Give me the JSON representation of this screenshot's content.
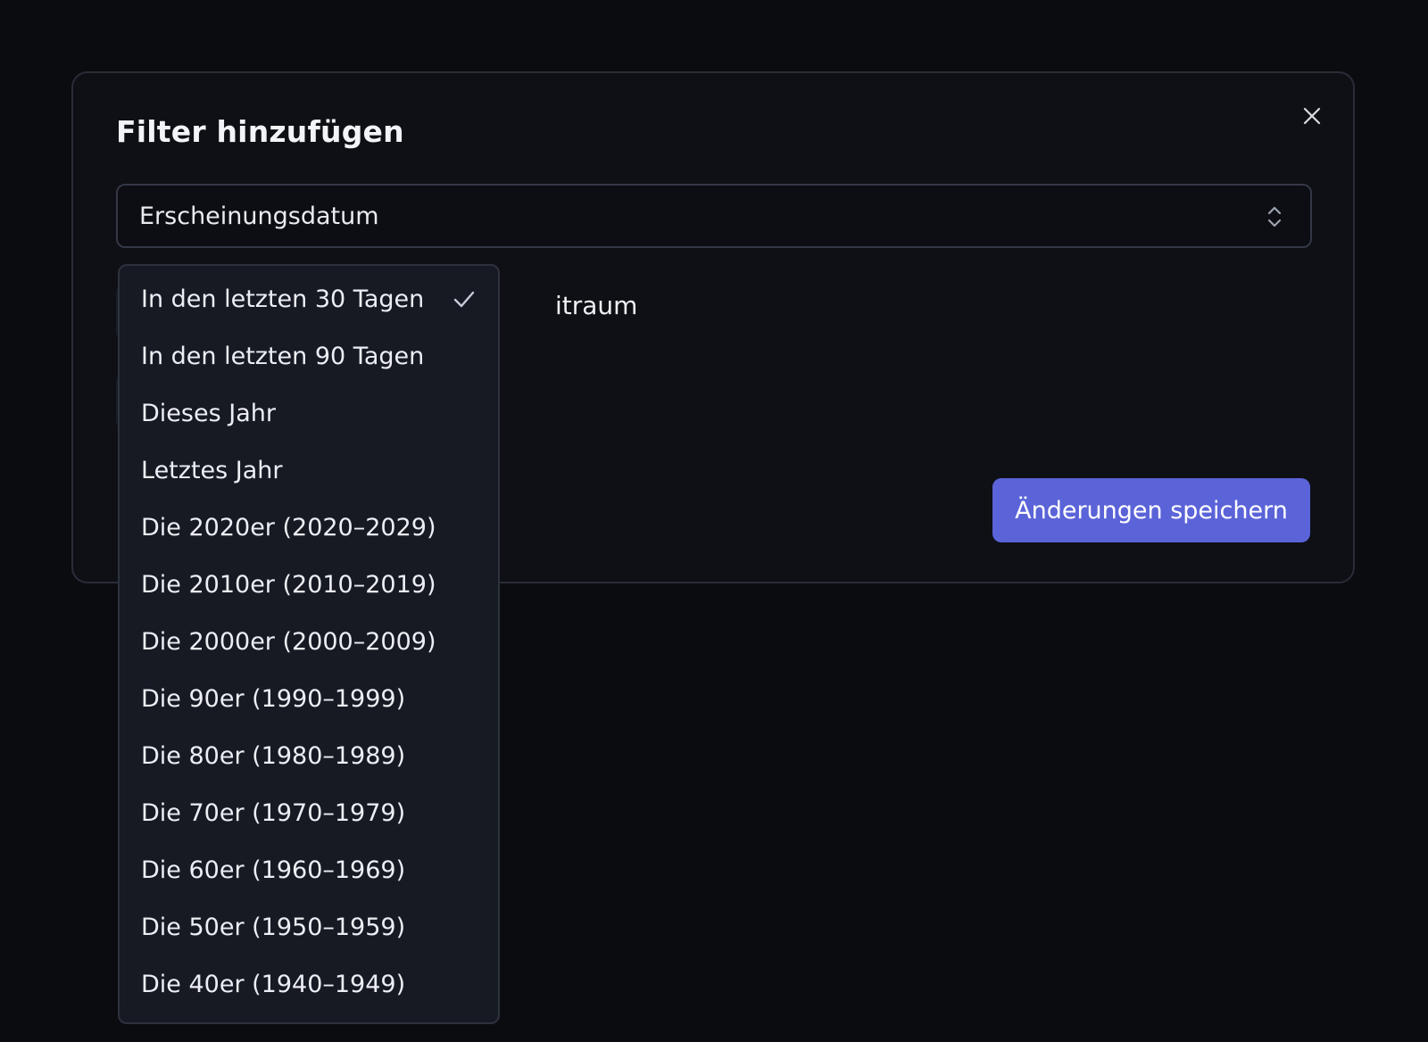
{
  "modal": {
    "title": "Filter hinzufügen",
    "close_icon": "close-icon"
  },
  "field_select": {
    "value": "Erscheinungsdatum",
    "icon": "chevron-up-down-icon"
  },
  "partial_label": "itraum",
  "dropdown": {
    "selected_index": 0,
    "check_icon": "check-icon",
    "options": [
      {
        "label": "In den letzten 30 Tagen",
        "selected": true
      },
      {
        "label": "In den letzten 90 Tagen",
        "selected": false
      },
      {
        "label": "Dieses Jahr",
        "selected": false
      },
      {
        "label": "Letztes Jahr",
        "selected": false
      },
      {
        "label": "Die 2020er (2020–2029)",
        "selected": false
      },
      {
        "label": "Die 2010er (2010–2019)",
        "selected": false
      },
      {
        "label": "Die 2000er (2000–2009)",
        "selected": false
      },
      {
        "label": "Die 90er (1990–1999)",
        "selected": false
      },
      {
        "label": "Die 80er (1980–1989)",
        "selected": false
      },
      {
        "label": "Die 70er (1970–1979)",
        "selected": false
      },
      {
        "label": "Die 60er (1960–1969)",
        "selected": false
      },
      {
        "label": "Die 50er (1950–1959)",
        "selected": false
      },
      {
        "label": "Die 40er (1940–1949)",
        "selected": false
      }
    ]
  },
  "actions": {
    "save_label": "Änderungen speichern"
  },
  "colors": {
    "page_background": "#0b0c10",
    "modal_background": "#0e1016",
    "dropdown_background": "#171a23",
    "accent": "#5b63d8",
    "text": "#eef0f5"
  }
}
